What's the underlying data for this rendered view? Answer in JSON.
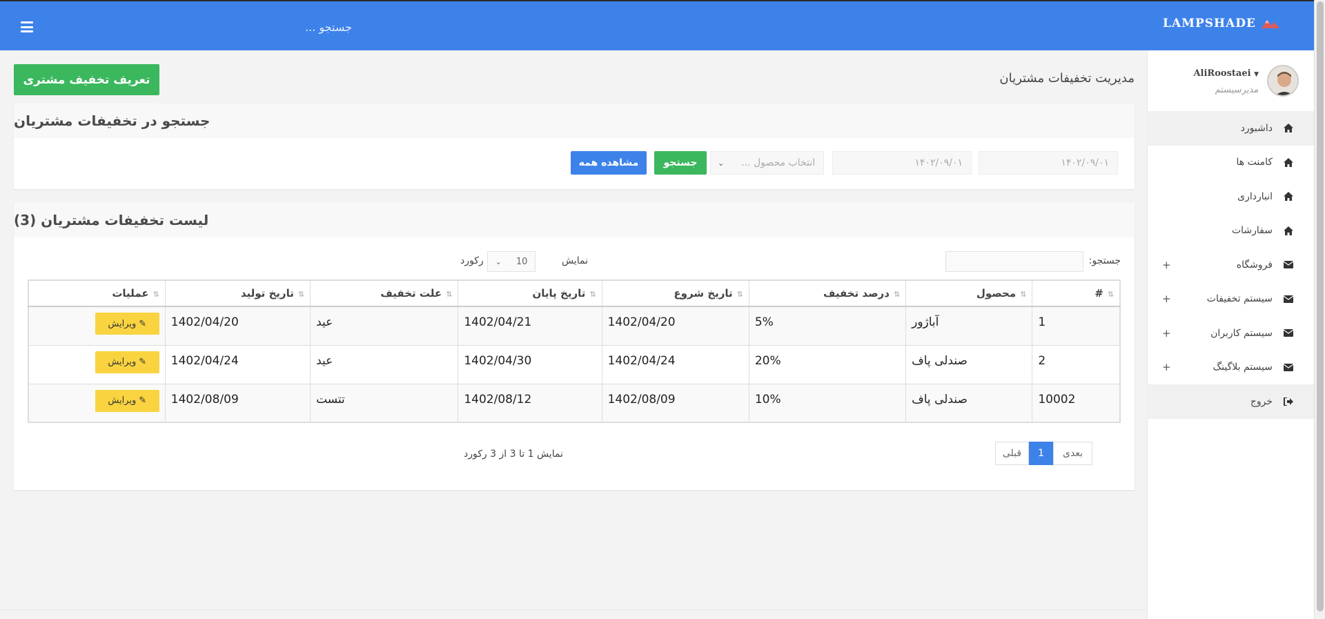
{
  "topbar": {
    "logo": "LAMPSHADE",
    "search_placeholder": "جستجو ..."
  },
  "sidebar": {
    "user_name": "AliRoostaei",
    "user_role": "مدیرسیستم",
    "items": [
      {
        "label": "داشبورد",
        "icon": "home-icon"
      },
      {
        "label": "کامنت ها",
        "icon": "home-icon"
      },
      {
        "label": "انبارداری",
        "icon": "home-icon"
      },
      {
        "label": "سفارشات",
        "icon": "home-icon"
      },
      {
        "label": "فروشگاه",
        "icon": "envelope-icon",
        "expand": "+"
      },
      {
        "label": "سیستم تخفیفات",
        "icon": "envelope-icon",
        "expand": "+"
      },
      {
        "label": "سیستم کاربران",
        "icon": "envelope-icon",
        "expand": "+"
      },
      {
        "label": "سیستم بلاگینگ",
        "icon": "envelope-icon",
        "expand": "+"
      },
      {
        "label": "خروج",
        "icon": "sign-out-icon"
      }
    ]
  },
  "page": {
    "title": "مدیریت تخفیفات مشتریان",
    "add_button": "تعریف تخفیف مشتری"
  },
  "search_panel": {
    "heading": "جستجو در تخفیفات مشتریان",
    "start_date": "۱۴۰۲/۰۹/۰۱",
    "end_date": "۱۴۰۲/۰۹/۰۱",
    "product_placeholder": "انتخاب محصول ...",
    "search_button": "جستجو",
    "show_all_button": "مشاهده همه"
  },
  "list_panel": {
    "heading": "لیست تخفیفات مشتریان (3)",
    "search_label": "جستجو:",
    "show_label": "نمایش",
    "page_size": "10",
    "records_label": "رکورد",
    "columns": [
      "#",
      "محصول",
      "درصد تخفیف",
      "تاریخ شروع",
      "تاریخ پایان",
      "علت تخفیف",
      "تاریخ تولید",
      "عملیات"
    ],
    "rows": [
      {
        "id": "1",
        "product": "آباژور",
        "percent": "5%",
        "start": "1402/04/20",
        "end": "1402/04/21",
        "reason": "عید",
        "created": "1402/04/20",
        "action": "ویرایش"
      },
      {
        "id": "2",
        "product": "صندلی پاف",
        "percent": "20%",
        "start": "1402/04/24",
        "end": "1402/04/30",
        "reason": "عید",
        "created": "1402/04/24",
        "action": "ویرایش"
      },
      {
        "id": "10002",
        "product": "صندلی پاف",
        "percent": "10%",
        "start": "1402/08/09",
        "end": "1402/08/12",
        "reason": "تتست",
        "created": "1402/08/09",
        "action": "ویرایش"
      }
    ],
    "info": "نمایش 1 تا 3 از 3 رکورد",
    "pager": {
      "next": "بعدی",
      "current": "1",
      "prev": "قبلی"
    }
  }
}
